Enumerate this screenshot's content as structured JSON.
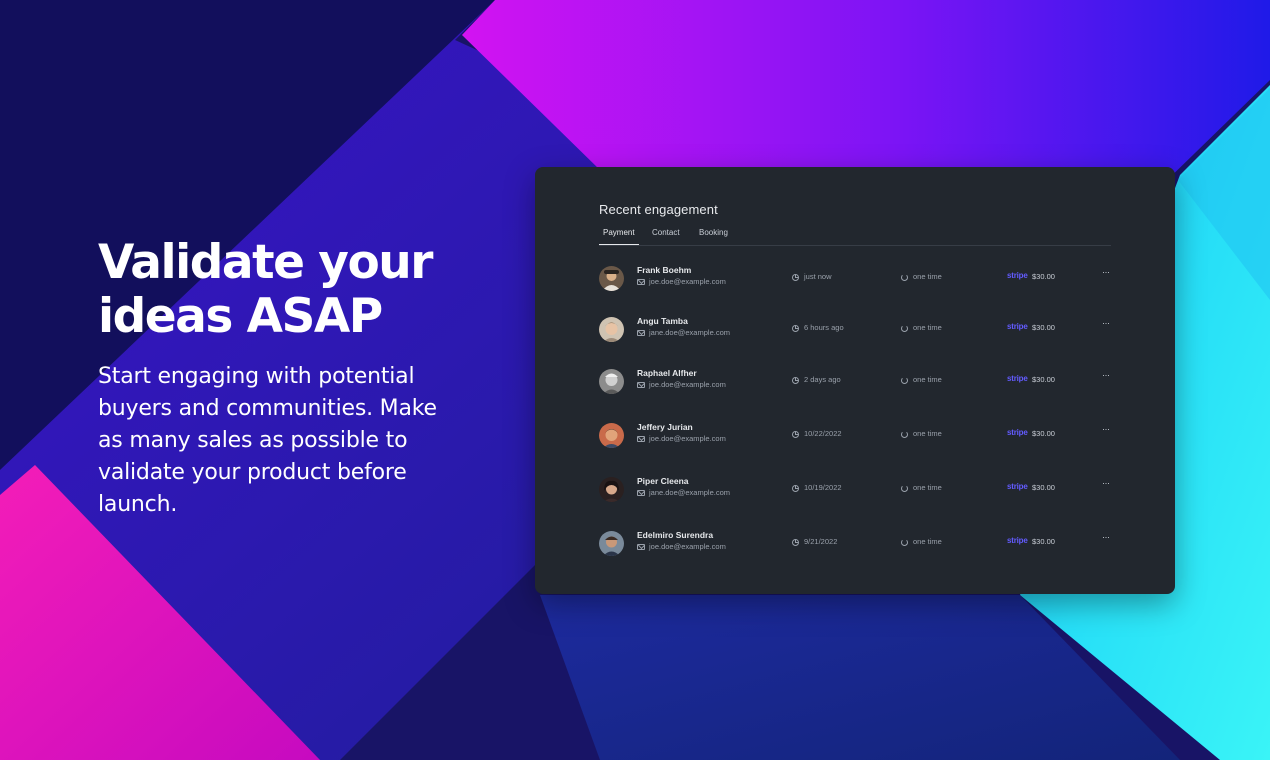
{
  "hero": {
    "title": "Validate your ideas ASAP",
    "subtitle": "Start engaging with potential buyers and communities. Make as many sales as possible to validate your product before launch."
  },
  "card": {
    "title": "Recent engagement",
    "tabs": [
      {
        "label": "Payment",
        "active": true
      },
      {
        "label": "Contact",
        "active": false
      },
      {
        "label": "Booking",
        "active": false
      }
    ]
  },
  "rows": [
    {
      "name": "Frank Boehm",
      "email": "joe.doe@example.com",
      "time": "just now",
      "frequency": "one time",
      "provider": "stripe",
      "amount": "$30.00",
      "more": "···"
    },
    {
      "name": "Angu Tamba",
      "email": "jane.doe@example.com",
      "time": "6 hours ago",
      "frequency": "one time",
      "provider": "stripe",
      "amount": "$30.00",
      "more": "···"
    },
    {
      "name": "Raphael Alfher",
      "email": "joe.doe@example.com",
      "time": "2 days ago",
      "frequency": "one time",
      "provider": "stripe",
      "amount": "$30.00",
      "more": "···"
    },
    {
      "name": "Jeffery Jurian",
      "email": "joe.doe@example.com",
      "time": "10/22/2022",
      "frequency": "one time",
      "provider": "stripe",
      "amount": "$30.00",
      "more": "···"
    },
    {
      "name": "Piper Cleena",
      "email": "jane.doe@example.com",
      "time": "10/19/2022",
      "frequency": "one time",
      "provider": "stripe",
      "amount": "$30.00",
      "more": "···"
    },
    {
      "name": "Edelmiro Surendra",
      "email": "joe.doe@example.com",
      "time": "9/21/2022",
      "frequency": "one time",
      "provider": "stripe",
      "amount": "$30.00",
      "more": "···"
    }
  ],
  "colors": {
    "card_background": "#22272e",
    "stripe_brand": "#635bff",
    "background_navy": "#1a1570",
    "background_magenta": "#e10bc4",
    "background_cyan": "#2de7f5"
  }
}
